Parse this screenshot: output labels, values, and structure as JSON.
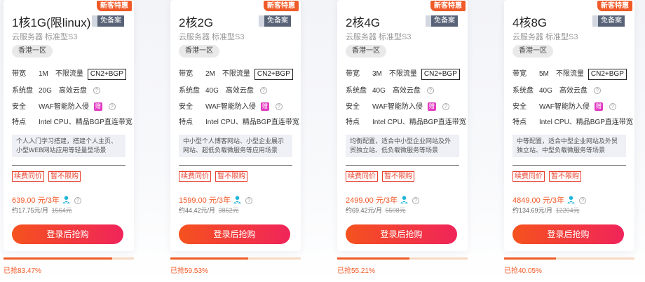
{
  "promo_label": "新客特惠",
  "free_tag": "免备案",
  "subtitle": "云服务器 标准型S3",
  "region": "香港一区",
  "labels": {
    "bandwidth": "带宽",
    "disk": "系统盘",
    "security": "安全",
    "feature": "特点",
    "unlimited": "不限流量",
    "cloud_disk": "高效云盘",
    "waf": "WAF智能防入侵",
    "gift": "赠",
    "help": "?",
    "features_text": "Intel CPU、精品BGP直连带宽",
    "line": "CN2+BGP",
    "renew": "续费同价",
    "no_limit": "暂不限购",
    "buy": "登录后抢购",
    "per_year": "/3年",
    "per_month_prefix": "约",
    "per_month_suffix": "/月"
  },
  "colors": {
    "accent": "#f05a28",
    "button_start": "#f5521e",
    "button_end": "#f0245a",
    "progress_bg": "#f5d9c4"
  },
  "plans": [
    {
      "title": "1核1G(限linux)",
      "bandwidth": "1M",
      "disk": "20G",
      "desc": "个人入门学习搭建，搭建个人主页、小型WEB网站应用等轻量型场景",
      "price": "639.00 元",
      "monthly": "17.75元",
      "old_price": "1564元",
      "sold_pct": 83.47,
      "sold_text": "已抢83.47%"
    },
    {
      "title": "2核2G",
      "bandwidth": "2M",
      "disk": "40G",
      "desc": "中小型个人博客网站、小型企业展示网站、超低负载微服务等应用场景",
      "price": "1599.00 元",
      "monthly": "44.42元",
      "old_price": "3852元",
      "sold_pct": 59.53,
      "sold_text": "已抢59.53%"
    },
    {
      "title": "2核4G",
      "bandwidth": "3M",
      "disk": "40G",
      "desc": "均衡配置，适合中小型企业网站及外贸独立站、低负载微服务等场景",
      "price": "2499.00 元",
      "monthly": "69.42元",
      "old_price": "5508元",
      "sold_pct": 55.21,
      "sold_text": "已抢55.21%"
    },
    {
      "title": "4核8G",
      "bandwidth": "5M",
      "disk": "40G",
      "desc": "中等配置，适合中型企业网站及外贸独立站、中型负载微服务等场景",
      "price": "4849.00 元",
      "monthly": "134.69元",
      "old_price": "12204元",
      "sold_pct": 40.05,
      "sold_text": "已抢40.05%"
    }
  ]
}
